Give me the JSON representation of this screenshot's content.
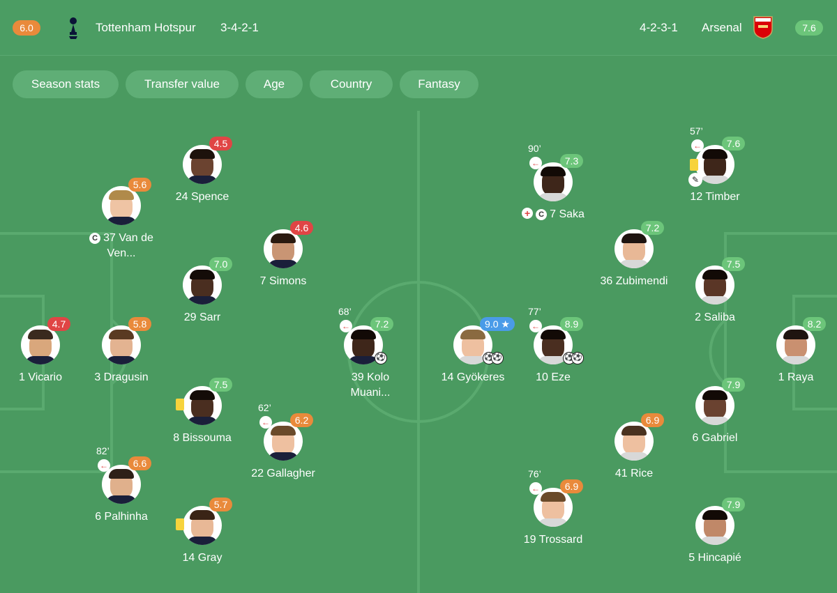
{
  "header": {
    "home": {
      "rating": "6.0",
      "name": "Tottenham Hotspur",
      "formation": "3-4-2-1"
    },
    "away": {
      "rating": "7.6",
      "name": "Arsenal",
      "formation": "4-2-3-1"
    }
  },
  "filters": [
    "Season stats",
    "Transfer value",
    "Age",
    "Country",
    "Fantasy"
  ],
  "home_players": [
    {
      "name": "1 Vicario",
      "rating": "4.7"
    },
    {
      "name": "3 Dragusin",
      "rating": "5.8"
    },
    {
      "name": "37 Van de Ven...",
      "rating": "5.6"
    },
    {
      "name": "6 Palhinha",
      "rating": "6.6",
      "minute": "82’"
    },
    {
      "name": "24 Spence",
      "rating": "4.5"
    },
    {
      "name": "29 Sarr",
      "rating": "7.0"
    },
    {
      "name": "8 Bissouma",
      "rating": "7.5"
    },
    {
      "name": "14 Gray",
      "rating": "5.7"
    },
    {
      "name": "7 Simons",
      "rating": "4.6"
    },
    {
      "name": "22 Gallagher",
      "rating": "6.2",
      "minute": "62’"
    },
    {
      "name": "39 Kolo Muani...",
      "rating": "7.2",
      "minute": "68’"
    }
  ],
  "away_players": [
    {
      "name": "1 Raya",
      "rating": "8.2"
    },
    {
      "name": "12 Timber",
      "rating": "7.6",
      "minute": "57’"
    },
    {
      "name": "2 Saliba",
      "rating": "7.5"
    },
    {
      "name": "6 Gabriel",
      "rating": "7.9"
    },
    {
      "name": "5 Hincapié",
      "rating": "7.9"
    },
    {
      "name": "36 Zubimendi",
      "rating": "7.2"
    },
    {
      "name": "41 Rice",
      "rating": "6.9"
    },
    {
      "name": "7 Saka",
      "rating": "7.3",
      "minute": "90’"
    },
    {
      "name": "10 Eze",
      "rating": "8.9",
      "minute": "77’"
    },
    {
      "name": "19 Trossard",
      "rating": "6.9",
      "minute": "76’"
    },
    {
      "name": "14 Gyökeres",
      "rating": "9.0"
    }
  ],
  "colors": {
    "pitch": "#4a9a60",
    "rating_red": "#e04545",
    "rating_orange": "#e98a3b",
    "rating_green": "#6cc57a",
    "rating_blue": "#4a9be8"
  }
}
